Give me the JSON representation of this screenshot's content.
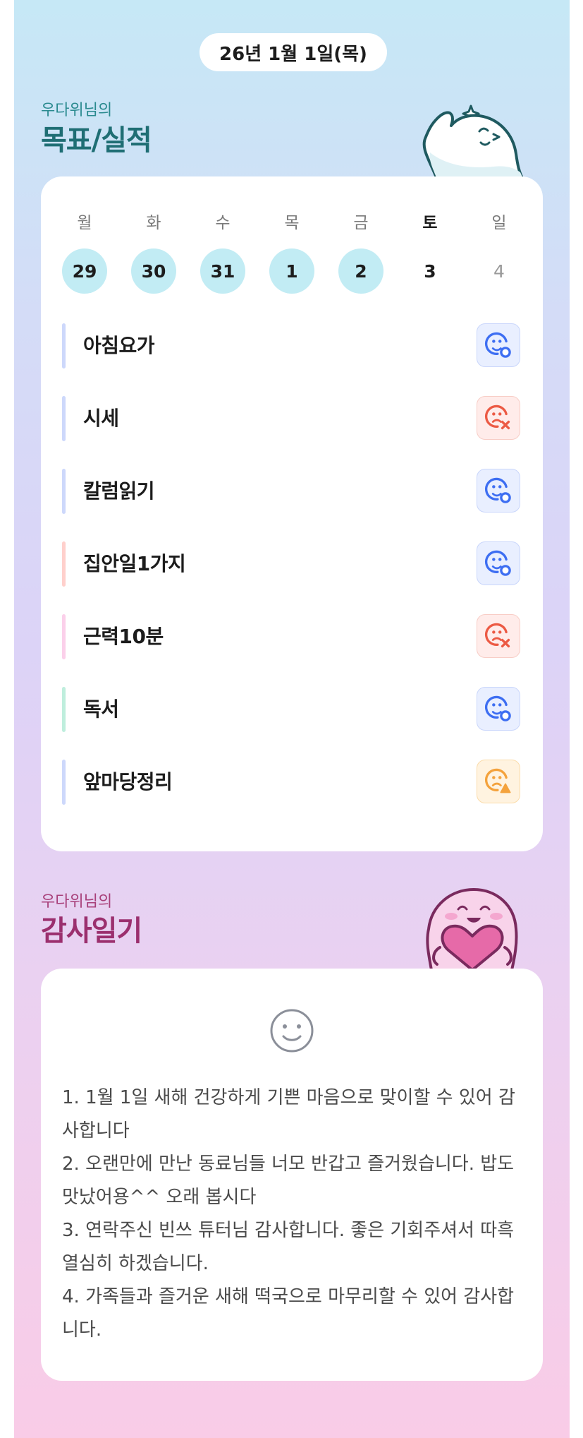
{
  "header": {
    "date": "26년 1월 1일(목)"
  },
  "goals_section": {
    "subtitle": "우다위님의",
    "title": "목표/실적",
    "calendar": {
      "weekdays": [
        "월",
        "화",
        "수",
        "목",
        "금",
        "토",
        "일"
      ],
      "days": [
        {
          "num": "29",
          "done": true
        },
        {
          "num": "30",
          "done": true
        },
        {
          "num": "31",
          "done": true
        },
        {
          "num": "1",
          "done": true
        },
        {
          "num": "2",
          "done": true
        },
        {
          "num": "3",
          "done": false
        },
        {
          "num": "4",
          "done": false
        }
      ]
    },
    "goals": [
      {
        "label": "아침요가",
        "bar_color": "#cdd8fb",
        "status": "success"
      },
      {
        "label": "시세",
        "bar_color": "#cdd8fb",
        "status": "fail"
      },
      {
        "label": "칼럼읽기",
        "bar_color": "#cdd8fb",
        "status": "success"
      },
      {
        "label": "집안일1가지",
        "bar_color": "#ffd0cc",
        "status": "success"
      },
      {
        "label": "근력10분",
        "bar_color": "#fbd0ea",
        "status": "fail"
      },
      {
        "label": "독서",
        "bar_color": "#bfeedd",
        "status": "success"
      },
      {
        "label": "앞마당정리",
        "bar_color": "#cdd8fb",
        "status": "partial"
      }
    ],
    "status_colors": {
      "success": "#3d6ef2",
      "fail": "#ec5a44",
      "partial": "#f4a23c"
    }
  },
  "gratitude_section": {
    "subtitle": "우다위님의",
    "title": "감사일기",
    "entries": [
      "1. 1월 1일 새해 건강하게 기쁜 마음으로 맞이할 수 있어 감사합니다",
      "2. 오랜만에 만난 동료님들 너모 반갑고 즐거웠습니다. 밥도 맛났어용^^ 오래 봅시다",
      "3. 연락주신 빈쓰 튜터님 감사합니다. 좋은 기회주셔서 따흑 열심히 하겠습니다.",
      "4. 가족들과 즐거운 새해 떡국으로 마무리할 수 있어 감사합니다."
    ]
  },
  "theme": {
    "goals_title_color": "#1f6e74",
    "goals_subtitle_color": "#2a8a8f",
    "gratitude_title_color": "#9b2f6e",
    "gratitude_subtitle_color": "#a8407a"
  },
  "icons": {
    "goals_mascot": "waving-ghost-mascot",
    "gratitude_mascot": "heart-hugging-mascot",
    "diary_mood": "smiley-face-icon"
  }
}
